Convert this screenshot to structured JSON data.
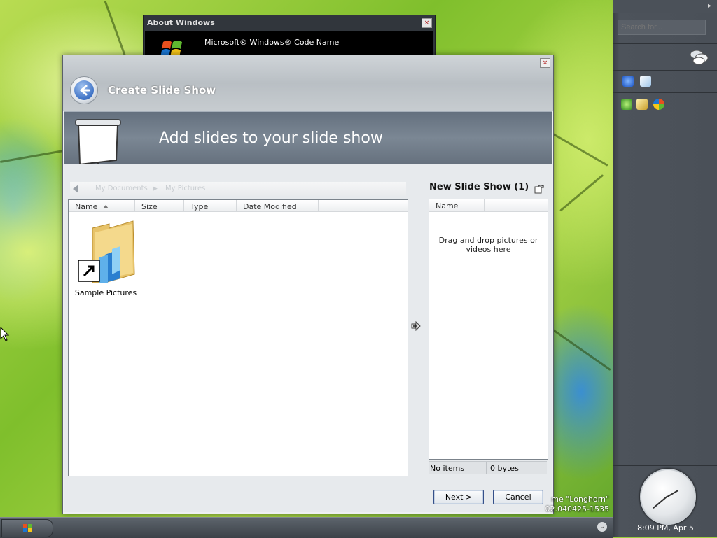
{
  "sidebar": {
    "search_placeholder": "Search for...",
    "clock_time": "8:09 PM, Apr 5",
    "icons": [
      "chat-bubbles-icon",
      "blue-gadget-icon",
      "cube-icon",
      "green-leaf-icon",
      "keys-icon",
      "windows-orb-icon"
    ]
  },
  "about_window": {
    "title": "About Windows",
    "product_line": "Microsoft® Windows® Code Name"
  },
  "branding": {
    "line1": "me \"Longhorn\"",
    "line2": "02.040425-1535"
  },
  "dialog": {
    "title": "Create Slide Show",
    "banner": "Add slides to your slide show",
    "close_label": "×",
    "breadcrumb": [
      "My Documents",
      "My Pictures"
    ],
    "file_columns": [
      "Name",
      "Size",
      "Type",
      "Date Modified"
    ],
    "files": [
      {
        "name": "Sample Pictures",
        "kind": "folder-shortcut"
      }
    ],
    "slide_show": {
      "title": "New Slide Show (1)",
      "column": "Name",
      "empty_text": "Drag and drop pictures or videos here",
      "items_status": "No items",
      "size_status": "0 bytes"
    },
    "buttons": {
      "next": "Next >",
      "cancel": "Cancel"
    }
  },
  "colors": {
    "banner": "#6f7b88",
    "sidebar": "#4a5058",
    "accent_button_border": "#35508a"
  }
}
